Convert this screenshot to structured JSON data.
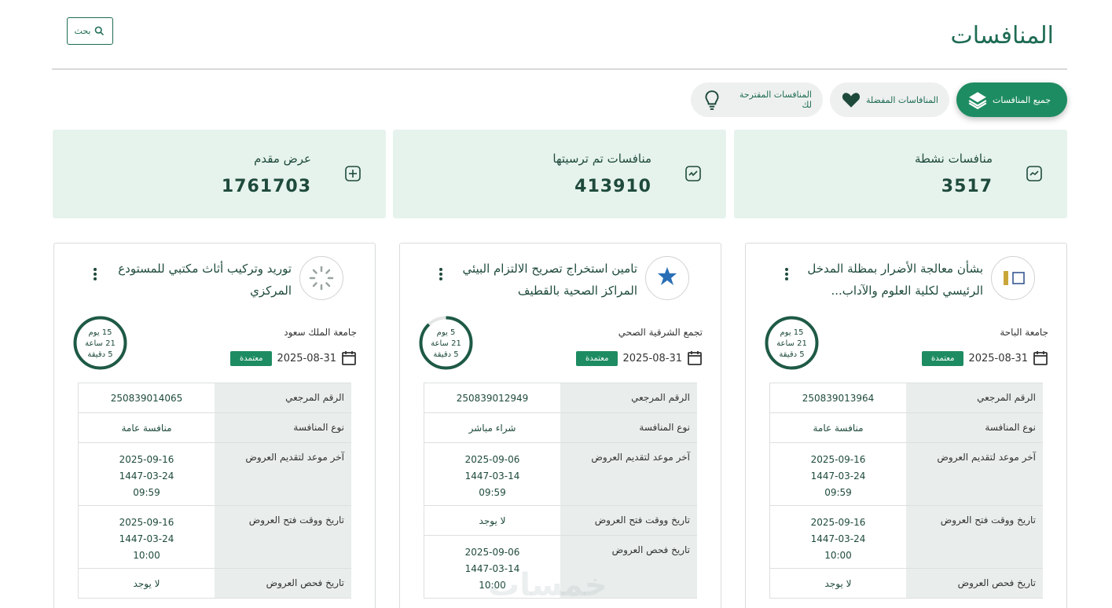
{
  "page": {
    "title": "المنافسات"
  },
  "search": {
    "label": "بحث"
  },
  "tabs": [
    {
      "label": "جميع المنافسات",
      "icon": "layers-icon"
    },
    {
      "label": "المنافاسات المفضلة",
      "icon": "heart-icon"
    },
    {
      "label": "المنافسات المقترحة لك",
      "icon": "lightbulb-icon"
    }
  ],
  "stats": [
    {
      "label": "منافسات نشطة",
      "value": "3517",
      "icon": "chart-line-icon"
    },
    {
      "label": "منافسات تم ترسيتها",
      "value": "413910",
      "icon": "check-box-icon"
    },
    {
      "label": "عرض مقدم",
      "value": "1761703",
      "icon": "plus-box-icon"
    }
  ],
  "labels": {
    "ref": "الرقم المرجعي",
    "type": "نوع المنافسة",
    "deadline": "آخر موعد لتقديم العروض",
    "opening": "تاريخ ووقت فتح العروض",
    "examination": "تاريخ فحص العروض",
    "status": "معتمدة"
  },
  "cards": [
    {
      "title": "بشأن معالجة الأضرار بمظلة المدخل الرئيسي لكلية العلوم والآداب...",
      "org": "جامعة الباحة",
      "date": "2025-08-31",
      "timer": [
        "15 يوم",
        "21 ساعة",
        "5 دقيقة"
      ],
      "progress": 1.0,
      "ref": "250839013964",
      "type": "منافسة عامة",
      "deadline": [
        "2025-09-16",
        "1447-03-24",
        "09:59"
      ],
      "opening": [
        "2025-09-16",
        "1447-03-24",
        "10:00"
      ],
      "examination": "لا يوجد"
    },
    {
      "title": "تامين استخراج تصريح الالتزام البيئي المراكز الصحية بالقطيف",
      "org": "تجمع الشرقية الصحي",
      "date": "2025-08-31",
      "timer": [
        "5 يوم",
        "21 ساعة",
        "5 دقيقة"
      ],
      "progress": 0.88,
      "ref": "250839012949",
      "type": "شراء مباشر",
      "deadline": [
        "2025-09-06",
        "1447-03-14",
        "09:59"
      ],
      "opening": "لا يوجد",
      "examination": [
        "2025-09-06",
        "1447-03-14",
        "10:00"
      ]
    },
    {
      "title": "توريد وتركيب أثاث مكتبي للمستودع المركزي",
      "org": "جامعة الملك سعود",
      "date": "2025-08-31",
      "timer": [
        "15 يوم",
        "21 ساعة",
        "5 دقيقة"
      ],
      "progress": 1.0,
      "ref": "250839014065",
      "type": "منافسة عامة",
      "deadline": [
        "2025-09-16",
        "1447-03-24",
        "09:59"
      ],
      "opening": [
        "2025-09-16",
        "1447-03-24",
        "10:00"
      ],
      "examination": "لا يوجد"
    }
  ],
  "watermark": "خمسات",
  "colors": {
    "primary": "#1e8c62",
    "dark": "#1e4a3c",
    "stat_bg": "#e6f3ec"
  }
}
